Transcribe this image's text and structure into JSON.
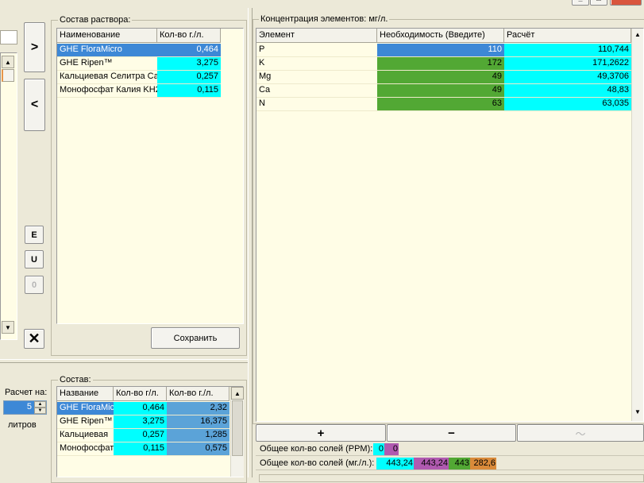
{
  "window_controls": {
    "minimize": "_",
    "maximize": "□",
    "close": "✕"
  },
  "transfer_buttons": {
    "add": ">",
    "remove": "<"
  },
  "side_buttons": {
    "e": "E",
    "u": "U",
    "o": "0",
    "delete": "✕"
  },
  "solution_panel": {
    "title": "Состав раствора:",
    "columns": [
      "Наименование",
      "Кол-во г./л."
    ],
    "rows": [
      {
        "name": "GHE FloraMicro",
        "qty": "0,464"
      },
      {
        "name": "GHE Ripen™",
        "qty": "3,275"
      },
      {
        "name": "Кальциевая Селитра Са",
        "qty": "0,257"
      },
      {
        "name": "Монофосфат Калия KH2",
        "qty": "0,115"
      }
    ],
    "save_label": "Сохранить"
  },
  "calc": {
    "label": "Расчет на:",
    "value": "5",
    "unit": "литров"
  },
  "composition_panel": {
    "title": "Состав:",
    "columns": [
      "Название",
      "Кол-во г/л.",
      "Кол-во г./л."
    ],
    "rows": [
      {
        "name": "GHE FloraMicro",
        "qty": "0,464",
        "total": "2,32"
      },
      {
        "name": "GHE Ripen™",
        "qty": "3,275",
        "total": "16,375"
      },
      {
        "name": "Кальциевая",
        "qty": "0,257",
        "total": "1,285"
      },
      {
        "name": "Монофосфат",
        "qty": "0,115",
        "total": "0,575"
      }
    ]
  },
  "concentration_panel": {
    "title": "Концентрация элементов: мг/л.",
    "columns": [
      "Элемент",
      "Необходимость (Введите)",
      "Расчёт"
    ],
    "rows": [
      {
        "element": "P",
        "need": "110",
        "calc": "110,744"
      },
      {
        "element": "K",
        "need": "172",
        "calc": "171,2622"
      },
      {
        "element": "Mg",
        "need": "49",
        "calc": "49,3706"
      },
      {
        "element": "Ca",
        "need": "49",
        "calc": "48,83"
      },
      {
        "element": "N",
        "need": "63",
        "calc": "63,035"
      }
    ]
  },
  "toolbar": {
    "add": "+",
    "remove": "−",
    "chart": "〜"
  },
  "totals": {
    "ppm_label": "Общее кол-во солей (PPM):",
    "ppm_values": [
      "0",
      "0"
    ],
    "mg_label": "Общее кол-во солей (мг./л.):",
    "mg_values": [
      "443,24",
      "443,24",
      "443",
      "282,6"
    ]
  },
  "colors": {
    "selected": "#3d88d6",
    "cyan": "#00ffff",
    "green": "#52a834",
    "blue": "#5ba3d8",
    "magenta": "#b05ab0",
    "orange": "#d98a3a",
    "cream": "#fffde6"
  }
}
